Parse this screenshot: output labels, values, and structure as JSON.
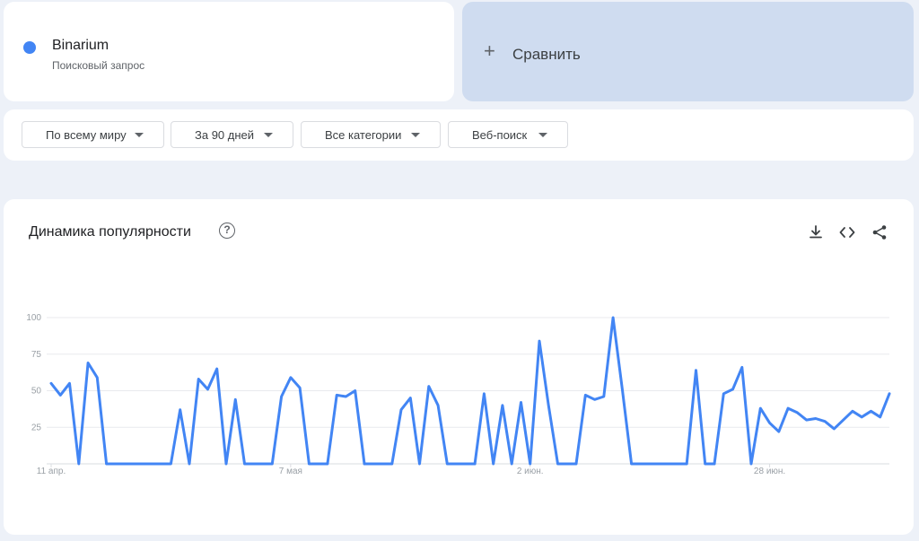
{
  "term": {
    "name": "Binarium",
    "subtitle": "Поисковый запрос",
    "color": "#4285f4"
  },
  "compare": {
    "label": "Сравнить",
    "icon": "plus-icon"
  },
  "filters": [
    {
      "label": "По всему миру",
      "icon": "caret-down-icon"
    },
    {
      "label": "За 90 дней",
      "icon": "caret-down-icon"
    },
    {
      "label": "Все категории",
      "icon": "caret-down-icon"
    },
    {
      "label": "Веб-поиск",
      "icon": "caret-down-icon"
    }
  ],
  "chart_card": {
    "title": "Динамика популярности",
    "icons": [
      "help-icon",
      "download-icon",
      "embed-code-icon",
      "share-icon"
    ]
  },
  "chart_data": {
    "type": "line",
    "title": "Динамика популярности",
    "xlabel": "",
    "ylabel": "",
    "ylim": [
      0,
      100
    ],
    "yticks": [
      25,
      50,
      75,
      100
    ],
    "xtick_labels": [
      {
        "index": 0,
        "label": "11 апр."
      },
      {
        "index": 26,
        "label": "7 мая"
      },
      {
        "index": 52,
        "label": "2 июн."
      },
      {
        "index": 78,
        "label": "28 июн."
      }
    ],
    "grid": true,
    "legend": "none",
    "series": [
      {
        "color": "#4285f4",
        "values": [
          55,
          47,
          55,
          0,
          69,
          59,
          0,
          0,
          0,
          0,
          0,
          0,
          0,
          0,
          37,
          0,
          58,
          51,
          65,
          0,
          44,
          0,
          0,
          0,
          0,
          46,
          59,
          52,
          0,
          0,
          0,
          47,
          46,
          50,
          0,
          0,
          0,
          0,
          37,
          45,
          0,
          53,
          40,
          0,
          0,
          0,
          0,
          48,
          0,
          40,
          0,
          42,
          0,
          84,
          40,
          0,
          0,
          0,
          47,
          44,
          46,
          100,
          51,
          0,
          0,
          0,
          0,
          0,
          0,
          0,
          64,
          0,
          0,
          48,
          51,
          66,
          0,
          38,
          28,
          22,
          38,
          35,
          30,
          31,
          29,
          24,
          30,
          36,
          32,
          36,
          32,
          48
        ]
      }
    ]
  }
}
